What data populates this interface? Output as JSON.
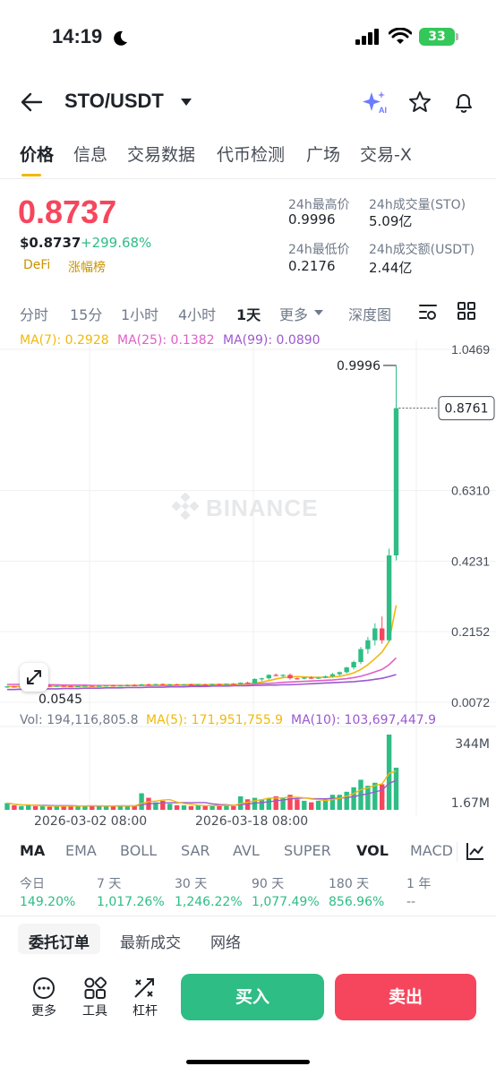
{
  "status_bar": {
    "time": "14:19",
    "battery": "33"
  },
  "header": {
    "pair": "STO/USDT"
  },
  "tabs": [
    "价格",
    "信息",
    "交易数据",
    "代币检测",
    "广场",
    "交易-X"
  ],
  "price": {
    "last": "0.8737",
    "usd": "$0.8737",
    "change": "+299.68%",
    "tags": [
      "DeFi",
      "涨幅榜"
    ],
    "high_label": "24h最高价",
    "high": "0.9996",
    "vol_sto_label": "24h成交量(STO)",
    "vol_sto": "5.09亿",
    "low_label": "24h最低价",
    "low": "0.2176",
    "vol_usdt_label": "24h成交额(USDT)",
    "vol_usdt": "2.44亿"
  },
  "intervals": [
    "分时",
    "15分",
    "1小时",
    "4小时",
    "1天",
    "更多",
    "深度图"
  ],
  "ma_legend": {
    "ma7": "MA(7): 0.2928",
    "ma25": "MA(25): 0.1382",
    "ma99": "MA(99): 0.0890"
  },
  "vol_legend": {
    "vol": "Vol: 194,116,805.8",
    "ma5": "MA(5): 171,951,755.9",
    "ma10": "MA(10): 103,697,447.9"
  },
  "watermark": "BINANCE",
  "colors": {
    "up": "#2ebd85",
    "down": "#f6465d",
    "accent": "#f0b90b",
    "ma7": "#f0b90b",
    "ma25": "#e05fc6",
    "ma99": "#9b59d0"
  },
  "chart_data": {
    "type": "candlestick",
    "y_ticks": [
      "1.0469",
      "0.6310",
      "0.4231",
      "0.2152",
      "0.0072"
    ],
    "current_price_label": "0.8761",
    "high_marker": "0.9996",
    "low_marker": "0.0545",
    "volume_ticks": [
      "344M",
      "1.67M"
    ],
    "x_ticks": [
      "2026-03-02 08:00",
      "2026-03-18 08:00"
    ],
    "candles": [
      {
        "o": 0.052,
        "h": 0.056,
        "l": 0.05,
        "c": 0.054,
        "v": 9
      },
      {
        "o": 0.054,
        "h": 0.056,
        "l": 0.052,
        "c": 0.053,
        "v": 6
      },
      {
        "o": 0.053,
        "h": 0.055,
        "l": 0.051,
        "c": 0.054,
        "v": 5
      },
      {
        "o": 0.054,
        "h": 0.057,
        "l": 0.053,
        "c": 0.056,
        "v": 6
      },
      {
        "o": 0.056,
        "h": 0.058,
        "l": 0.054,
        "c": 0.055,
        "v": 5
      },
      {
        "o": 0.055,
        "h": 0.057,
        "l": 0.053,
        "c": 0.056,
        "v": 5
      },
      {
        "o": 0.056,
        "h": 0.058,
        "l": 0.054,
        "c": 0.055,
        "v": 4
      },
      {
        "o": 0.055,
        "h": 0.057,
        "l": 0.053,
        "c": 0.056,
        "v": 5
      },
      {
        "o": 0.056,
        "h": 0.058,
        "l": 0.054,
        "c": 0.055,
        "v": 5
      },
      {
        "o": 0.055,
        "h": 0.057,
        "l": 0.053,
        "c": 0.054,
        "v": 6
      },
      {
        "o": 0.054,
        "h": 0.056,
        "l": 0.052,
        "c": 0.055,
        "v": 5
      },
      {
        "o": 0.055,
        "h": 0.057,
        "l": 0.053,
        "c": 0.056,
        "v": 5
      },
      {
        "o": 0.056,
        "h": 0.058,
        "l": 0.054,
        "c": 0.055,
        "v": 6
      },
      {
        "o": 0.055,
        "h": 0.057,
        "l": 0.053,
        "c": 0.056,
        "v": 5
      },
      {
        "o": 0.056,
        "h": 0.058,
        "l": 0.054,
        "c": 0.057,
        "v": 5
      },
      {
        "o": 0.057,
        "h": 0.059,
        "l": 0.055,
        "c": 0.056,
        "v": 5
      },
      {
        "o": 0.056,
        "h": 0.058,
        "l": 0.054,
        "c": 0.057,
        "v": 6
      },
      {
        "o": 0.057,
        "h": 0.06,
        "l": 0.055,
        "c": 0.058,
        "v": 5
      },
      {
        "o": 0.058,
        "h": 0.061,
        "l": 0.056,
        "c": 0.057,
        "v": 5
      },
      {
        "o": 0.057,
        "h": 0.062,
        "l": 0.056,
        "c": 0.06,
        "v": 22
      },
      {
        "o": 0.06,
        "h": 0.063,
        "l": 0.056,
        "c": 0.058,
        "v": 16
      },
      {
        "o": 0.058,
        "h": 0.062,
        "l": 0.057,
        "c": 0.061,
        "v": 10
      },
      {
        "o": 0.061,
        "h": 0.063,
        "l": 0.058,
        "c": 0.059,
        "v": 12
      },
      {
        "o": 0.059,
        "h": 0.062,
        "l": 0.058,
        "c": 0.06,
        "v": 8
      },
      {
        "o": 0.06,
        "h": 0.062,
        "l": 0.058,
        "c": 0.059,
        "v": 6
      },
      {
        "o": 0.059,
        "h": 0.061,
        "l": 0.057,
        "c": 0.06,
        "v": 6
      },
      {
        "o": 0.06,
        "h": 0.062,
        "l": 0.058,
        "c": 0.059,
        "v": 5
      },
      {
        "o": 0.059,
        "h": 0.061,
        "l": 0.057,
        "c": 0.06,
        "v": 6
      },
      {
        "o": 0.06,
        "h": 0.062,
        "l": 0.058,
        "c": 0.059,
        "v": 5
      },
      {
        "o": 0.059,
        "h": 0.062,
        "l": 0.058,
        "c": 0.061,
        "v": 6
      },
      {
        "o": 0.061,
        "h": 0.063,
        "l": 0.059,
        "c": 0.06,
        "v": 6
      },
      {
        "o": 0.06,
        "h": 0.063,
        "l": 0.059,
        "c": 0.062,
        "v": 7
      },
      {
        "o": 0.062,
        "h": 0.064,
        "l": 0.06,
        "c": 0.061,
        "v": 5
      },
      {
        "o": 0.061,
        "h": 0.066,
        "l": 0.06,
        "c": 0.065,
        "v": 18
      },
      {
        "o": 0.065,
        "h": 0.068,
        "l": 0.061,
        "c": 0.063,
        "v": 14
      },
      {
        "o": 0.063,
        "h": 0.078,
        "l": 0.062,
        "c": 0.076,
        "v": 16
      },
      {
        "o": 0.076,
        "h": 0.08,
        "l": 0.07,
        "c": 0.078,
        "v": 14
      },
      {
        "o": 0.078,
        "h": 0.09,
        "l": 0.074,
        "c": 0.088,
        "v": 16
      },
      {
        "o": 0.088,
        "h": 0.092,
        "l": 0.084,
        "c": 0.086,
        "v": 18
      },
      {
        "o": 0.086,
        "h": 0.09,
        "l": 0.08,
        "c": 0.088,
        "v": 16
      },
      {
        "o": 0.088,
        "h": 0.092,
        "l": 0.074,
        "c": 0.078,
        "v": 20
      },
      {
        "o": 0.078,
        "h": 0.08,
        "l": 0.074,
        "c": 0.077,
        "v": 14
      },
      {
        "o": 0.077,
        "h": 0.082,
        "l": 0.075,
        "c": 0.08,
        "v": 12
      },
      {
        "o": 0.08,
        "h": 0.084,
        "l": 0.076,
        "c": 0.078,
        "v": 10
      },
      {
        "o": 0.078,
        "h": 0.082,
        "l": 0.076,
        "c": 0.08,
        "v": 12
      },
      {
        "o": 0.08,
        "h": 0.086,
        "l": 0.078,
        "c": 0.084,
        "v": 14
      },
      {
        "o": 0.084,
        "h": 0.094,
        "l": 0.082,
        "c": 0.09,
        "v": 20
      },
      {
        "o": 0.09,
        "h": 0.098,
        "l": 0.086,
        "c": 0.096,
        "v": 20
      },
      {
        "o": 0.096,
        "h": 0.112,
        "l": 0.092,
        "c": 0.11,
        "v": 24
      },
      {
        "o": 0.11,
        "h": 0.13,
        "l": 0.104,
        "c": 0.126,
        "v": 30
      },
      {
        "o": 0.126,
        "h": 0.17,
        "l": 0.12,
        "c": 0.164,
        "v": 40
      },
      {
        "o": 0.164,
        "h": 0.2,
        "l": 0.15,
        "c": 0.19,
        "v": 32
      },
      {
        "o": 0.19,
        "h": 0.24,
        "l": 0.175,
        "c": 0.225,
        "v": 36
      },
      {
        "o": 0.225,
        "h": 0.26,
        "l": 0.18,
        "c": 0.19,
        "v": 34
      },
      {
        "o": 0.19,
        "h": 0.46,
        "l": 0.185,
        "c": 0.44,
        "v": 100
      },
      {
        "o": 0.44,
        "h": 0.9996,
        "l": 0.425,
        "c": 0.8737,
        "v": 56
      }
    ],
    "ma7": [
      0.054,
      0.054,
      0.054,
      0.055,
      0.055,
      0.055,
      0.055,
      0.055,
      0.055,
      0.055,
      0.055,
      0.055,
      0.055,
      0.055,
      0.056,
      0.056,
      0.056,
      0.057,
      0.057,
      0.058,
      0.058,
      0.058,
      0.059,
      0.059,
      0.059,
      0.059,
      0.06,
      0.06,
      0.059,
      0.06,
      0.06,
      0.06,
      0.06,
      0.061,
      0.062,
      0.064,
      0.067,
      0.071,
      0.076,
      0.08,
      0.082,
      0.083,
      0.082,
      0.081,
      0.081,
      0.081,
      0.082,
      0.084,
      0.088,
      0.094,
      0.104,
      0.118,
      0.136,
      0.155,
      0.187,
      0.2928
    ],
    "ma25": [
      0.06,
      0.06,
      0.06,
      0.06,
      0.06,
      0.059,
      0.059,
      0.059,
      0.058,
      0.058,
      0.058,
      0.058,
      0.057,
      0.057,
      0.057,
      0.057,
      0.057,
      0.057,
      0.057,
      0.057,
      0.057,
      0.057,
      0.057,
      0.057,
      0.058,
      0.058,
      0.058,
      0.058,
      0.058,
      0.058,
      0.059,
      0.059,
      0.059,
      0.06,
      0.06,
      0.061,
      0.062,
      0.063,
      0.064,
      0.066,
      0.067,
      0.068,
      0.069,
      0.07,
      0.071,
      0.072,
      0.073,
      0.075,
      0.077,
      0.08,
      0.084,
      0.09,
      0.097,
      0.104,
      0.118,
      0.1382
    ],
    "ma99": [
      0.045,
      0.045,
      0.046,
      0.046,
      0.046,
      0.047,
      0.047,
      0.047,
      0.048,
      0.048,
      0.048,
      0.049,
      0.049,
      0.049,
      0.05,
      0.05,
      0.05,
      0.051,
      0.051,
      0.051,
      0.052,
      0.052,
      0.052,
      0.053,
      0.053,
      0.053,
      0.054,
      0.054,
      0.054,
      0.055,
      0.055,
      0.055,
      0.056,
      0.056,
      0.056,
      0.057,
      0.057,
      0.058,
      0.058,
      0.059,
      0.059,
      0.06,
      0.061,
      0.062,
      0.063,
      0.064,
      0.065,
      0.066,
      0.067,
      0.068,
      0.07,
      0.072,
      0.075,
      0.078,
      0.083,
      0.089
    ]
  },
  "indicators": [
    "MA",
    "EMA",
    "BOLL",
    "SAR",
    "AVL",
    "SUPER",
    "VOL",
    "MACD"
  ],
  "performance": [
    {
      "label": "今日",
      "value": "149.20%"
    },
    {
      "label": "7 天",
      "value": "1,017.26%"
    },
    {
      "label": "30 天",
      "value": "1,246.22%"
    },
    {
      "label": "90 天",
      "value": "1,077.49%"
    },
    {
      "label": "180 天",
      "value": "856.96%"
    },
    {
      "label": "1 年",
      "value": "--"
    }
  ],
  "bottom_tabs": [
    "委托订单",
    "最新成交",
    "网络"
  ],
  "toolbar": {
    "more": "更多",
    "tools": "工具",
    "leverage": "杠杆",
    "buy": "买入",
    "sell": "卖出"
  }
}
